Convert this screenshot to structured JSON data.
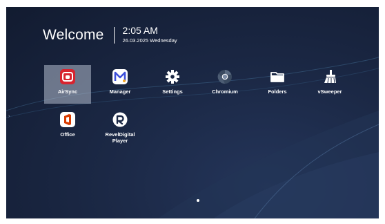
{
  "header": {
    "welcome": "Welcome",
    "time": "2:05 AM",
    "date": "26.03.2025 Wednesday"
  },
  "apps": [
    {
      "label": "AirSync",
      "icon": "airsync-icon",
      "selected": true
    },
    {
      "label": "Manager",
      "icon": "manager-icon"
    },
    {
      "label": "Settings",
      "icon": "gear-icon"
    },
    {
      "label": "Chromium",
      "icon": "chromium-icon"
    },
    {
      "label": "Folders",
      "icon": "folder-icon"
    },
    {
      "label": "vSweeper",
      "icon": "broom-icon"
    },
    {
      "label": "Office",
      "icon": "office-icon"
    },
    {
      "label": "RevelDigital Player",
      "icon": "reveldigital-icon"
    }
  ],
  "pager": {
    "pages": 1,
    "current": 1
  },
  "colors": {
    "background": "#1b2845",
    "airsync_red": "#d8232f",
    "manager_blue": "#3d4fd9",
    "office_red": "#d83b01",
    "selected_tile": "#b4becd"
  }
}
